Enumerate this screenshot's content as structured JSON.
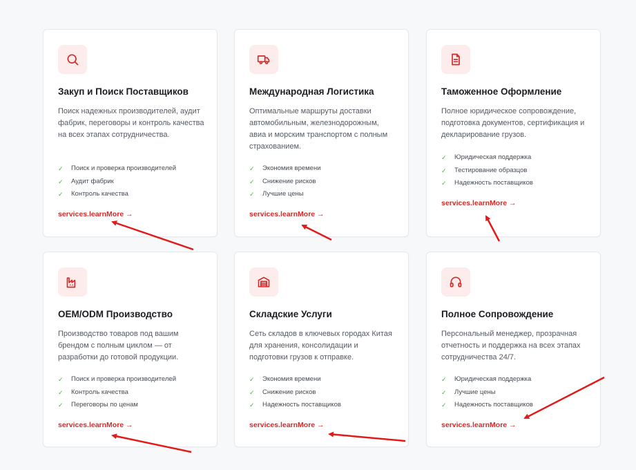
{
  "accent_color": "#d42a2a",
  "check_color": "#4caf50",
  "cards": [
    {
      "icon": "search-icon",
      "title": "Закуп и Поиск Поставщиков",
      "desc": "Поиск надежных производителей, аудит фабрик, переговоры и контроль качества на всех этапах сотрудничества.",
      "features": [
        "Поиск и проверка производителей",
        "Аудит фабрик",
        "Контроль качества"
      ],
      "link": "services.learnMore →"
    },
    {
      "icon": "truck-icon",
      "title": "Международная Логистика",
      "desc": "Оптимальные маршруты доставки автомобильным, железнодорожным, авиа и морским транспортом с полным страхованием.",
      "features": [
        "Экономия времени",
        "Снижение рисков",
        "Лучшие цены"
      ],
      "link": "services.learnMore →"
    },
    {
      "icon": "document-icon",
      "title": "Таможенное Оформление",
      "desc": "Полное юридическое сопровождение, подготовка документов, сертификация и декларирование грузов.",
      "features": [
        "Юридическая поддержка",
        "Тестирование образцов",
        "Надежность поставщиков"
      ],
      "link": "services.learnMore →"
    },
    {
      "icon": "factory-icon",
      "title": "OEM/ODM Производство",
      "desc": "Производство товаров под вашим брендом с полным циклом — от разработки до готовой продукции.",
      "features": [
        "Поиск и проверка производителей",
        "Контроль качества",
        "Переговоры по ценам"
      ],
      "link": "services.learnMore →"
    },
    {
      "icon": "warehouse-icon",
      "title": "Складские Услуги",
      "desc": "Сеть складов в ключевых городах Китая для хранения, консолидации и подготовки грузов к отправке.",
      "features": [
        "Экономия времени",
        "Снижение рисков",
        "Надежность поставщиков"
      ],
      "link": "services.learnMore →"
    },
    {
      "icon": "headphones-icon",
      "title": "Полное Сопровождение",
      "desc": "Персональный менеджер, прозрачная отчетность и поддержка на всех этапах сотрудничества 24/7.",
      "features": [
        "Юридическая поддержка",
        "Лучшие цены",
        "Надежность поставщиков"
      ],
      "link": "services.learnMore →"
    }
  ]
}
